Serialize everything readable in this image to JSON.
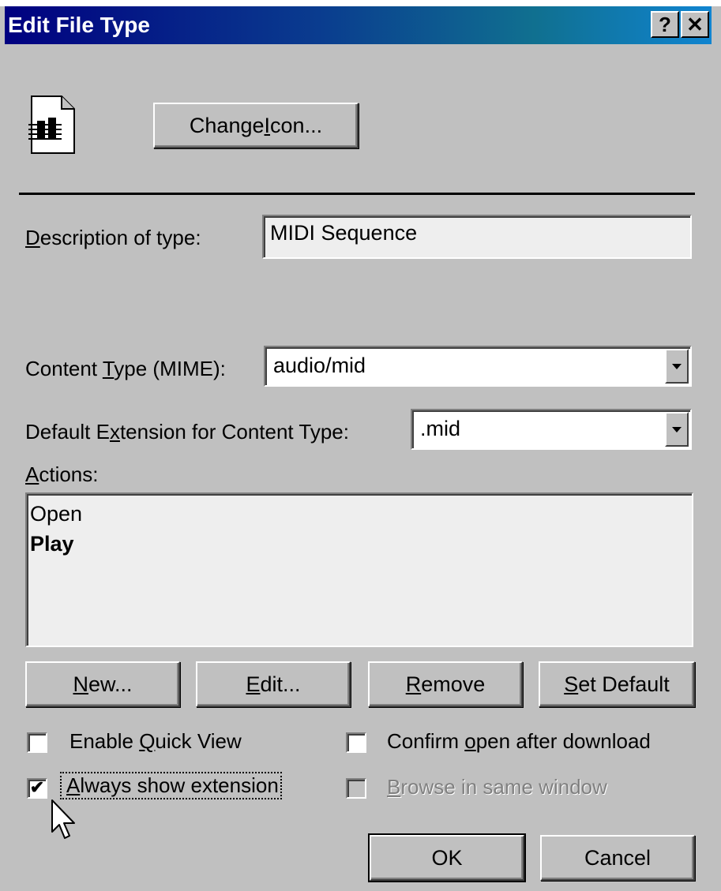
{
  "window": {
    "title": "Edit File Type",
    "help_btn": "?",
    "close_btn": "✕"
  },
  "change_icon_button": {
    "pre": "Change ",
    "u": "I",
    "post": "con..."
  },
  "description": {
    "label_u": "D",
    "label_rest": "escription of type:",
    "value": "MIDI Sequence"
  },
  "content_type": {
    "label_pre": "Content ",
    "label_u": "T",
    "label_post": "ype (MIME):",
    "value": "audio/mid"
  },
  "default_ext": {
    "label_pre": "Default E",
    "label_u": "x",
    "label_post": "tension for Content Type:",
    "value": ".mid"
  },
  "actions": {
    "label_u": "A",
    "label_rest": "ctions:",
    "items": [
      "Open",
      "Play"
    ]
  },
  "buttons": {
    "new": {
      "u": "N",
      "rest": "ew..."
    },
    "edit": {
      "u": "E",
      "rest": "dit..."
    },
    "remove": {
      "u": "R",
      "rest": "emove"
    },
    "set_default": {
      "u": "S",
      "rest": "et Default"
    },
    "ok": "OK",
    "cancel": "Cancel"
  },
  "checkboxes": {
    "quick_view": {
      "pre": "Enable ",
      "u": "Q",
      "post": "uick View",
      "checked": false
    },
    "confirm_open": {
      "pre": "Confirm ",
      "u": "o",
      "post": "pen after download",
      "checked": false
    },
    "always_show": {
      "u": "A",
      "post": "lways show extension",
      "checked": true,
      "mark": "✔"
    },
    "browse_same": {
      "u": "B",
      "post": "rowse in same window",
      "checked": false,
      "disabled": true
    }
  }
}
